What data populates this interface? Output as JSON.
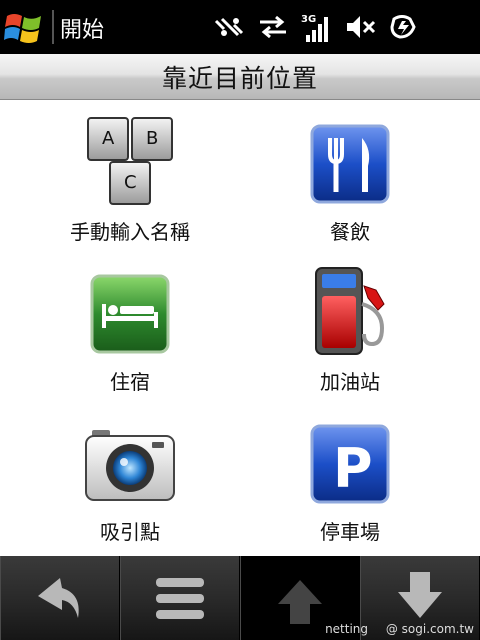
{
  "statusbar": {
    "start_label": "開始",
    "icons": [
      "windows-logo-icon",
      "connectivity-off-icon",
      "data-transfer-icon",
      "signal-3g-icon",
      "volume-mute-icon",
      "battery-charging-icon"
    ],
    "network_label": "3G"
  },
  "title": "靠近目前位置",
  "items": [
    {
      "label": "手動輸入名稱",
      "icon": "abc-keys-icon"
    },
    {
      "label": "餐飲",
      "icon": "fork-knife-icon"
    },
    {
      "label": "住宿",
      "icon": "bed-icon"
    },
    {
      "label": "加油站",
      "icon": "fuel-pump-icon"
    },
    {
      "label": "吸引點",
      "icon": "camera-icon"
    },
    {
      "label": "停車場",
      "icon": "parking-icon"
    }
  ],
  "keys": {
    "a": "A",
    "b": "B",
    "c": "C"
  },
  "parking_letter": "P",
  "toolbar": {
    "buttons": [
      "back-arrow-icon",
      "menu-icon",
      "scroll-up-icon",
      "scroll-down-icon"
    ]
  },
  "watermark": {
    "left": "netting",
    "right": "@ sogi.com.tw"
  },
  "colors": {
    "accent_blue": "#1c4fc8",
    "bed_green": "#2e8b2e",
    "fuel_red": "#d81414"
  }
}
